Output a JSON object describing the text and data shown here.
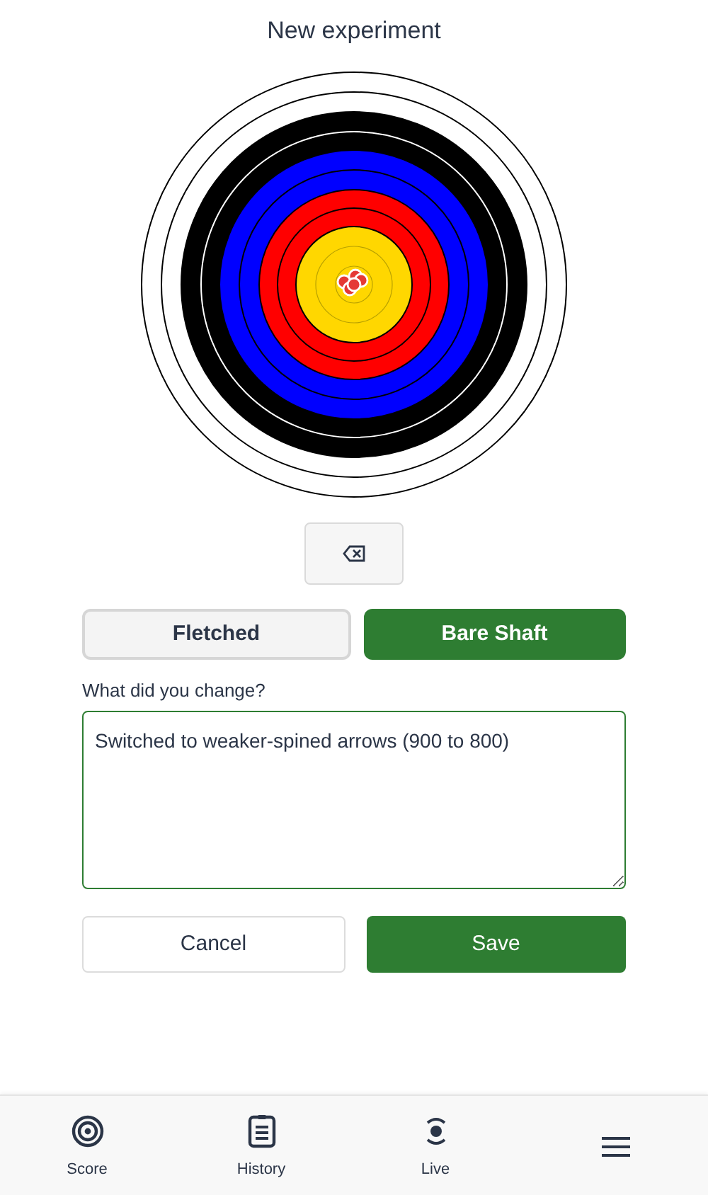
{
  "title": "New experiment",
  "segments": [
    {
      "label": "Fletched",
      "selected": false
    },
    {
      "label": "Bare Shaft",
      "selected": true
    }
  ],
  "change_field": {
    "label": "What did you change?",
    "value": "Switched to weaker-spined arrows (900 to 800)"
  },
  "buttons": [
    {
      "label": "Cancel",
      "kind": "secondary"
    },
    {
      "label": "Save",
      "kind": "primary"
    }
  ],
  "nav": [
    {
      "label": "Score"
    },
    {
      "label": "History"
    },
    {
      "label": "Live"
    }
  ]
}
